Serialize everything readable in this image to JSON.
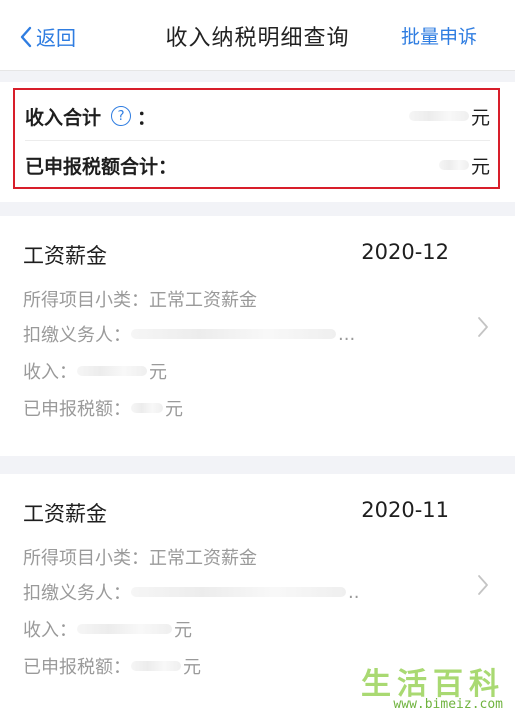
{
  "nav": {
    "back_label": "返回",
    "title": "收入纳税明细查询",
    "action_label": "批量申诉"
  },
  "summary": {
    "income_label": "收入合计",
    "income_colon": "：",
    "income_value_tail": "元",
    "tax_label": "已申报税额合计：",
    "tax_value_tail": "元"
  },
  "records": [
    {
      "type": "工资薪金",
      "period": "2020-12",
      "subtype_label": "所得项目小类：",
      "subtype_value": "正常工资薪金",
      "payer_label": "扣缴义务人：",
      "payer_tail": "...",
      "income_label": "收入：",
      "income_tail": "元",
      "tax_label": "已申报税额：",
      "tax_tail": "元"
    },
    {
      "type": "工资薪金",
      "period": "2020-11",
      "subtype_label": "所得项目小类：",
      "subtype_value": "正常工资薪金",
      "payer_label": "扣缴义务人：",
      "payer_tail": "..",
      "income_label": "收入：",
      "income_tail": "元",
      "tax_label": "已申报税额：",
      "tax_tail": "元"
    }
  ],
  "watermark": {
    "text": "生活百科",
    "url": "www.bimeiz.com"
  },
  "colors": {
    "accent": "#2f7de1",
    "highlight_border": "#d81e2a",
    "muted": "#9a9a9a"
  }
}
